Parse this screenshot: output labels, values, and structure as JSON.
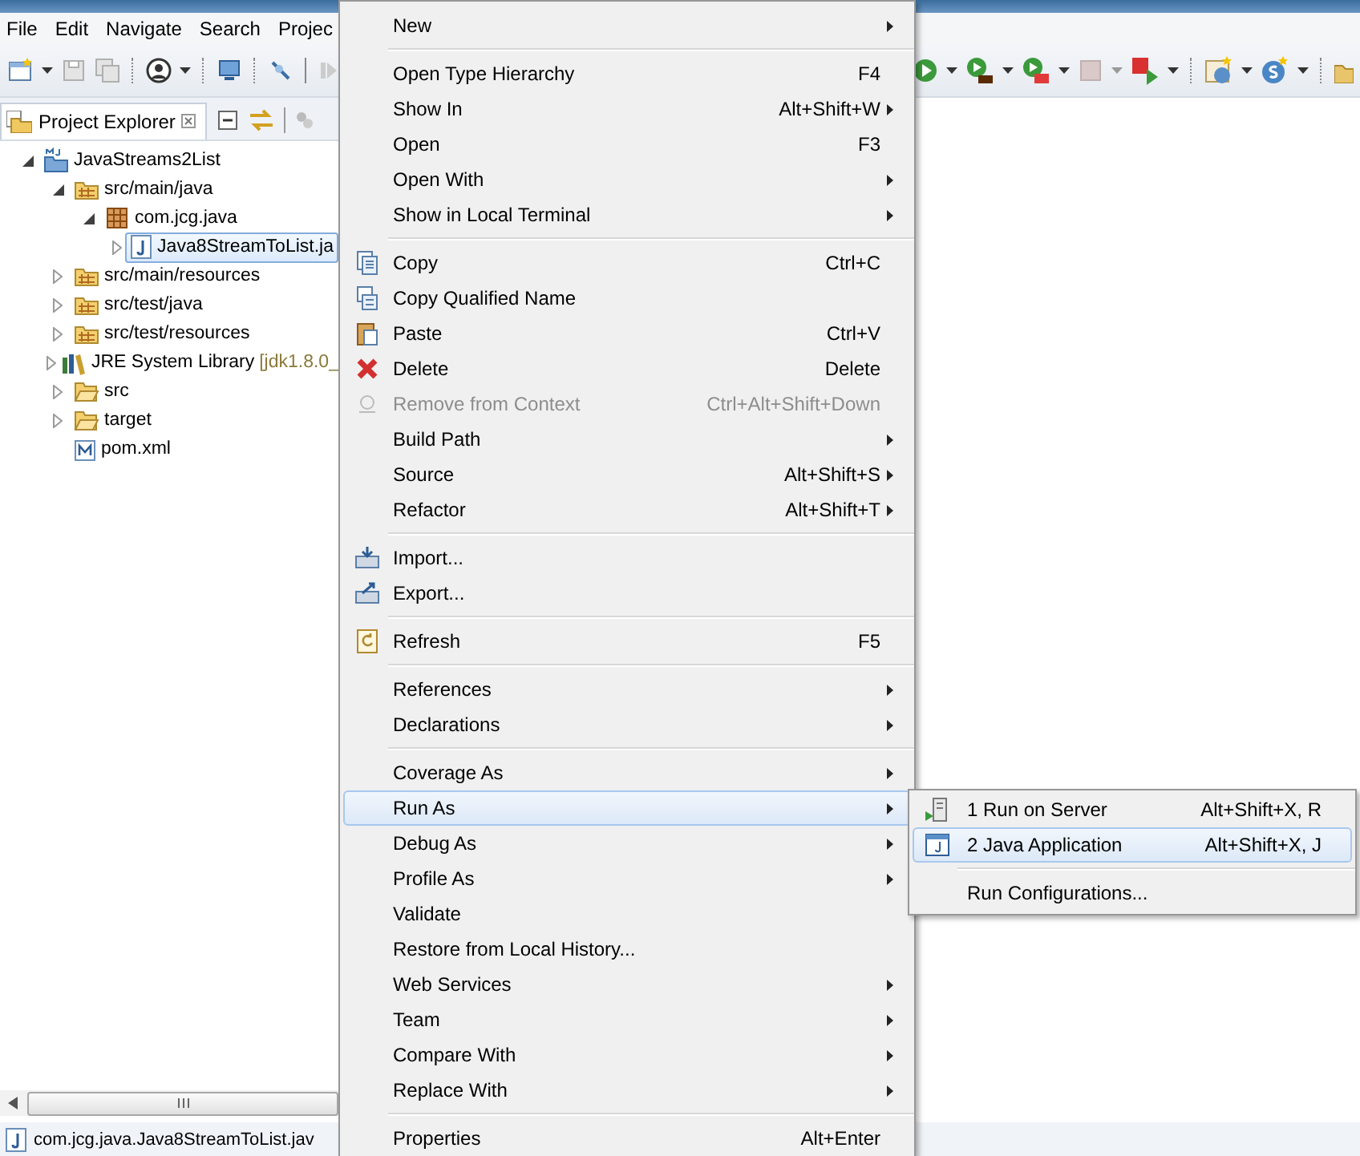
{
  "menubar": [
    {
      "label": "File"
    },
    {
      "label": "Edit"
    },
    {
      "label": "Navigate"
    },
    {
      "label": "Search"
    },
    {
      "label": "Projec"
    }
  ],
  "project_explorer": {
    "title": "Project Explorer",
    "tree": [
      {
        "kind": "project",
        "label": "JavaStreams2List",
        "expanded": true,
        "selected": false,
        "children": [
          {
            "kind": "source-folder",
            "label": "src/main/java",
            "expanded": true,
            "selected": false,
            "children": [
              {
                "kind": "package",
                "label": "com.jcg.java",
                "expanded": true,
                "selected": false,
                "children": [
                  {
                    "kind": "java-file",
                    "label": "Java8StreamToList.ja",
                    "expanded": false,
                    "selected": true
                  }
                ]
              }
            ]
          },
          {
            "kind": "source-folder",
            "label": "src/main/resources",
            "expanded": false,
            "selected": false
          },
          {
            "kind": "source-folder",
            "label": "src/test/java",
            "expanded": false,
            "selected": false
          },
          {
            "kind": "source-folder",
            "label": "src/test/resources",
            "expanded": false,
            "selected": false
          },
          {
            "kind": "library",
            "label": "JRE System Library",
            "decoration": "[jdk1.8.0_",
            "expanded": false,
            "selected": false
          },
          {
            "kind": "folder",
            "label": "src",
            "expanded": false,
            "selected": false
          },
          {
            "kind": "folder",
            "label": "target",
            "expanded": false,
            "selected": false
          },
          {
            "kind": "xml-file",
            "label": "pom.xml",
            "selected": false
          }
        ]
      }
    ]
  },
  "context_menu": {
    "items": [
      {
        "kind": "item",
        "label": "New",
        "submenu": true,
        "disabled": false,
        "selected": false
      },
      {
        "kind": "separator"
      },
      {
        "kind": "item",
        "label": "Open Type Hierarchy",
        "shortcut": "F4",
        "submenu": false,
        "disabled": false,
        "selected": false
      },
      {
        "kind": "item",
        "label": "Show In",
        "shortcut": "Alt+Shift+W",
        "submenu": true,
        "disabled": false,
        "selected": false
      },
      {
        "kind": "item",
        "label": "Open",
        "shortcut": "F3",
        "submenu": false,
        "disabled": false,
        "selected": false
      },
      {
        "kind": "item",
        "label": "Open With",
        "submenu": true,
        "disabled": false,
        "selected": false
      },
      {
        "kind": "item",
        "label": "Show in Local Terminal",
        "submenu": true,
        "disabled": false,
        "selected": false
      },
      {
        "kind": "separator"
      },
      {
        "kind": "item",
        "label": "Copy",
        "shortcut": "Ctrl+C",
        "submenu": false,
        "disabled": false,
        "selected": false
      },
      {
        "kind": "item",
        "label": "Copy Qualified Name",
        "submenu": false,
        "disabled": false,
        "selected": false
      },
      {
        "kind": "item",
        "label": "Paste",
        "shortcut": "Ctrl+V",
        "submenu": false,
        "disabled": false,
        "selected": false
      },
      {
        "kind": "item",
        "label": "Delete",
        "shortcut": "Delete",
        "submenu": false,
        "disabled": false,
        "selected": false
      },
      {
        "kind": "item",
        "label": "Remove from Context",
        "shortcut": "Ctrl+Alt+Shift+Down",
        "submenu": false,
        "disabled": true,
        "selected": false
      },
      {
        "kind": "item",
        "label": "Build Path",
        "submenu": true,
        "disabled": false,
        "selected": false
      },
      {
        "kind": "item",
        "label": "Source",
        "shortcut": "Alt+Shift+S",
        "submenu": true,
        "disabled": false,
        "selected": false
      },
      {
        "kind": "item",
        "label": "Refactor",
        "shortcut": "Alt+Shift+T",
        "submenu": true,
        "disabled": false,
        "selected": false
      },
      {
        "kind": "separator"
      },
      {
        "kind": "item",
        "label": "Import...",
        "submenu": false,
        "disabled": false,
        "selected": false
      },
      {
        "kind": "item",
        "label": "Export...",
        "submenu": false,
        "disabled": false,
        "selected": false
      },
      {
        "kind": "separator"
      },
      {
        "kind": "item",
        "label": "Refresh",
        "shortcut": "F5",
        "submenu": false,
        "disabled": false,
        "selected": false
      },
      {
        "kind": "separator"
      },
      {
        "kind": "item",
        "label": "References",
        "submenu": true,
        "disabled": false,
        "selected": false
      },
      {
        "kind": "item",
        "label": "Declarations",
        "submenu": true,
        "disabled": false,
        "selected": false
      },
      {
        "kind": "separator"
      },
      {
        "kind": "item",
        "label": "Coverage As",
        "submenu": true,
        "disabled": false,
        "selected": false
      },
      {
        "kind": "item",
        "label": "Run As",
        "submenu": true,
        "disabled": false,
        "selected": true
      },
      {
        "kind": "item",
        "label": "Debug As",
        "submenu": true,
        "disabled": false,
        "selected": false
      },
      {
        "kind": "item",
        "label": "Profile As",
        "submenu": true,
        "disabled": false,
        "selected": false
      },
      {
        "kind": "item",
        "label": "Validate",
        "submenu": false,
        "disabled": false,
        "selected": false
      },
      {
        "kind": "item",
        "label": "Restore from Local History...",
        "submenu": false,
        "disabled": false,
        "selected": false
      },
      {
        "kind": "item",
        "label": "Web Services",
        "submenu": true,
        "disabled": false,
        "selected": false
      },
      {
        "kind": "item",
        "label": "Team",
        "submenu": true,
        "disabled": false,
        "selected": false
      },
      {
        "kind": "item",
        "label": "Compare With",
        "submenu": true,
        "disabled": false,
        "selected": false
      },
      {
        "kind": "item",
        "label": "Replace With",
        "submenu": true,
        "disabled": false,
        "selected": false
      },
      {
        "kind": "separator"
      },
      {
        "kind": "item",
        "label": "Properties",
        "shortcut": "Alt+Enter",
        "submenu": false,
        "disabled": false,
        "selected": false
      }
    ]
  },
  "run_as_submenu": {
    "items": [
      {
        "kind": "item",
        "label": "1 Run on Server",
        "shortcut": "Alt+Shift+X, R",
        "selected": false
      },
      {
        "kind": "item",
        "label": "2 Java Application",
        "shortcut": "Alt+Shift+X, J",
        "selected": true
      },
      {
        "kind": "separator"
      },
      {
        "kind": "item",
        "label": "Run Configurations...",
        "selected": false
      }
    ]
  },
  "status_bar": {
    "text": "com.jcg.java.Java8StreamToList.jav"
  }
}
